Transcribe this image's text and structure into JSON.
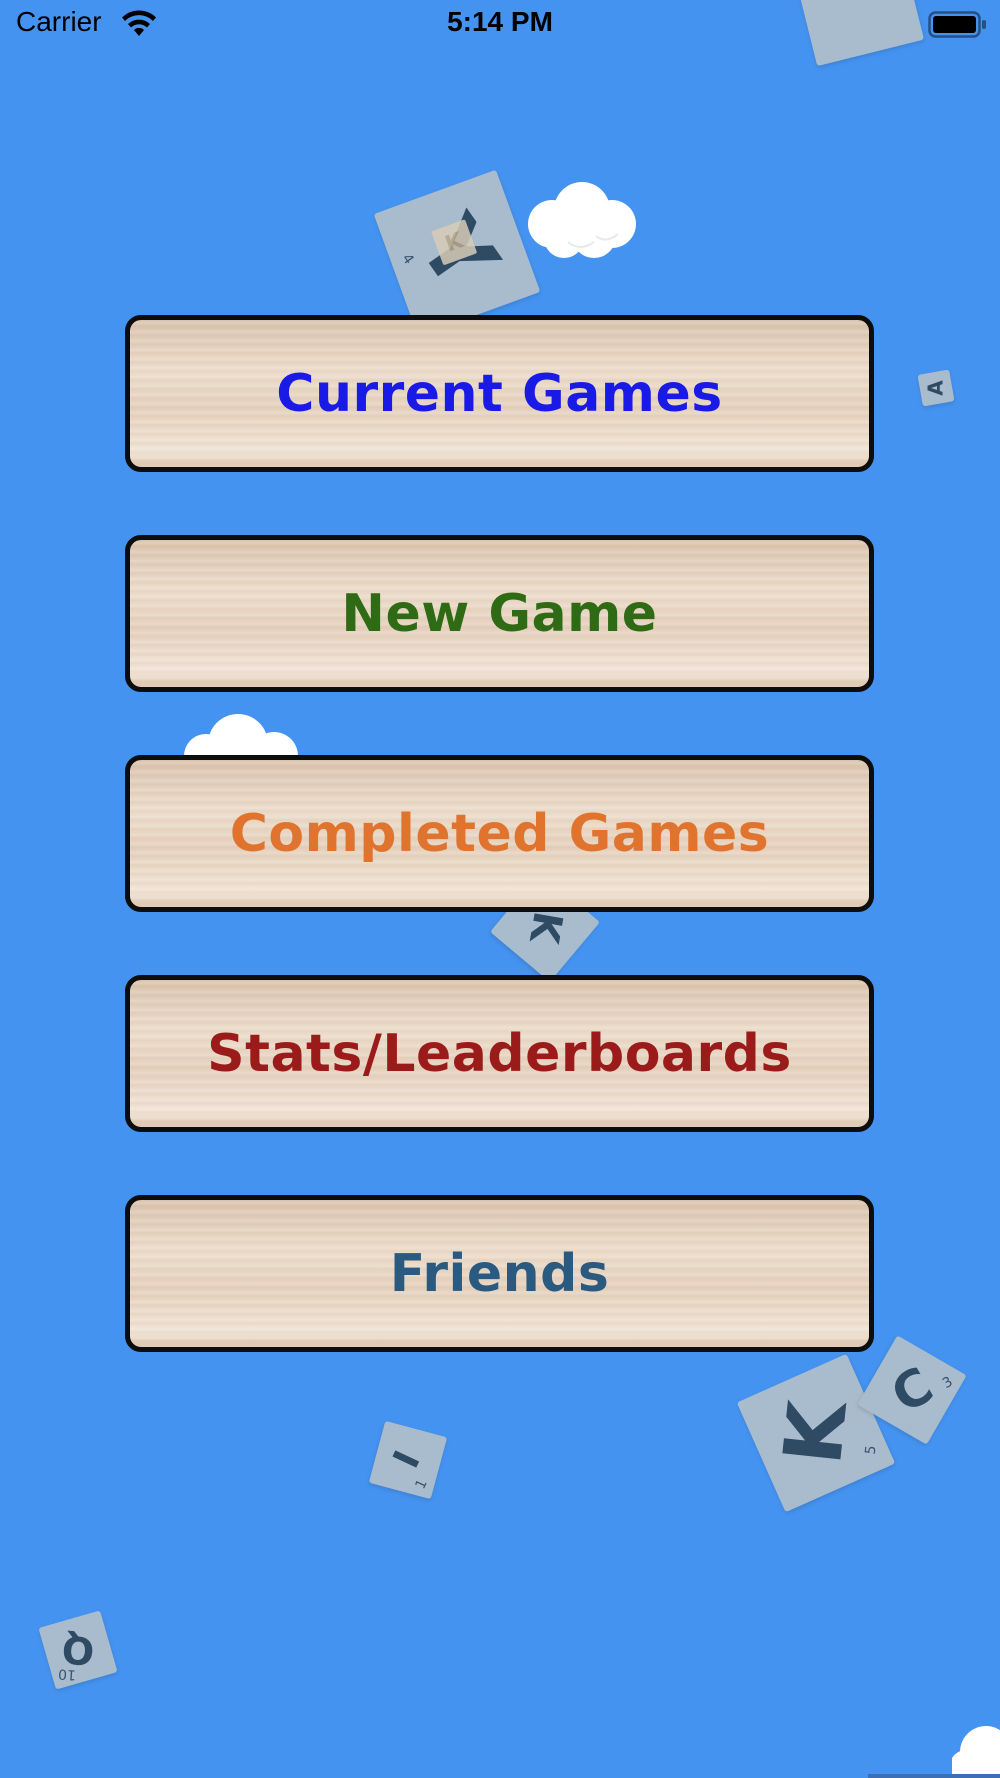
{
  "status_bar": {
    "carrier": "Carrier",
    "time": "5:14 PM"
  },
  "menu": {
    "items": [
      {
        "label": "Current Games",
        "color": "#1a1ae6"
      },
      {
        "label": "New Game",
        "color": "#2e6b14"
      },
      {
        "label": "Completed Games",
        "color": "#e0742e"
      },
      {
        "label": "Stats/Leaderboards",
        "color": "#9b1a1a"
      },
      {
        "label": "Friends",
        "color": "#2a5a80"
      }
    ]
  },
  "tiles": [
    {
      "letter": "Y",
      "value": "4"
    },
    {
      "letter": "K",
      "value": ""
    },
    {
      "letter": "A",
      "value": ""
    },
    {
      "letter": "K",
      "value": "5"
    },
    {
      "letter": "C",
      "value": "3"
    },
    {
      "letter": "I",
      "value": "1"
    },
    {
      "letter": "Q",
      "value": "10"
    },
    {
      "letter": "K",
      "value": "5"
    }
  ],
  "colors": {
    "background": "#4593f0",
    "tile": "#a9bccd",
    "button_border": "#0d0d0d"
  }
}
